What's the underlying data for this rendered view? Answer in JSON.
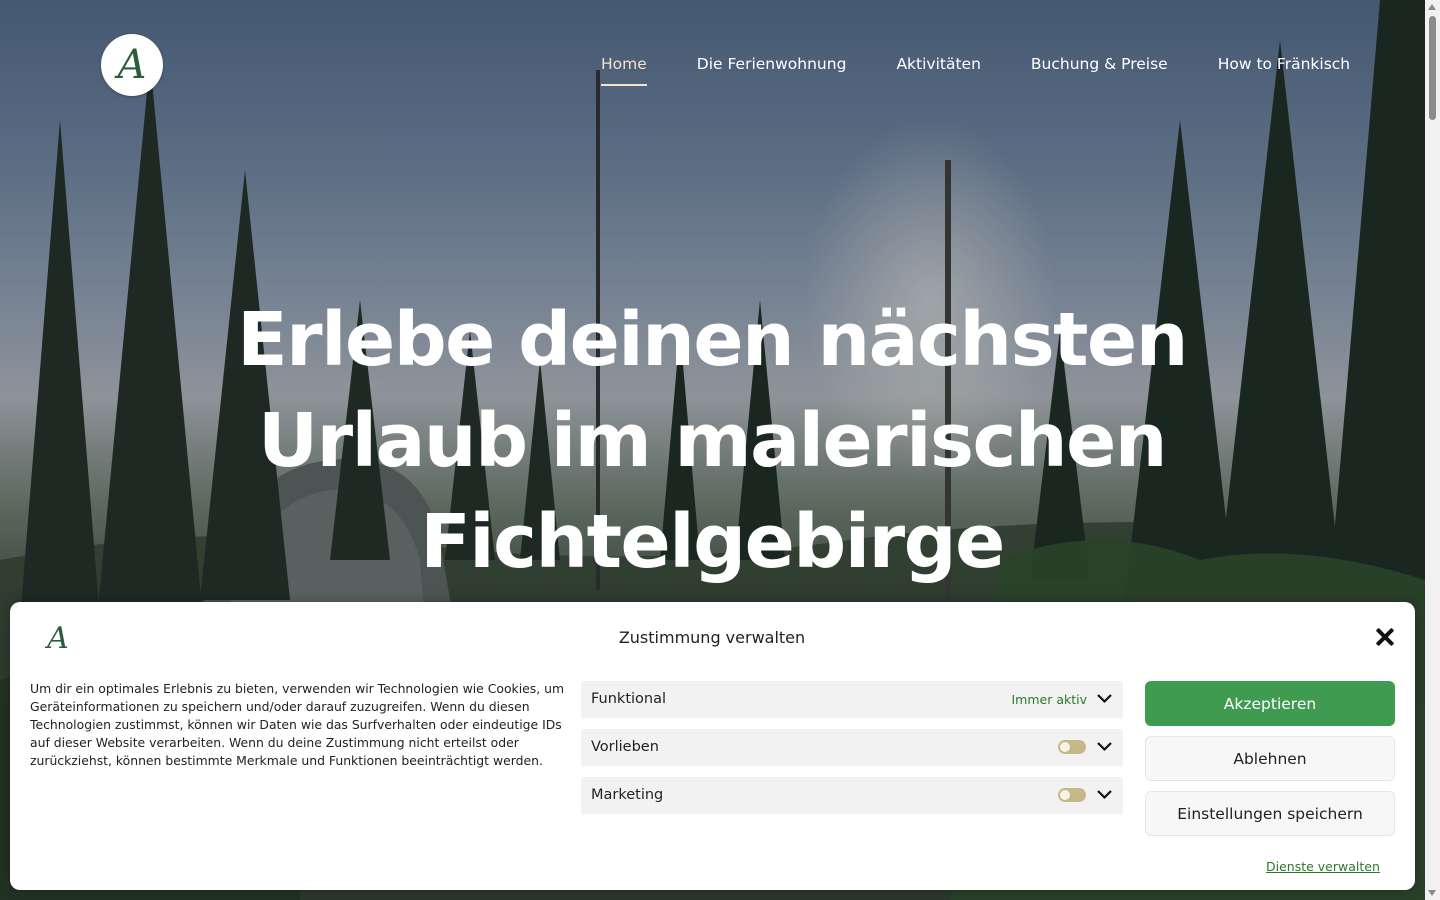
{
  "header": {
    "logo_alt": "A",
    "nav": [
      {
        "label": "Home",
        "active": true
      },
      {
        "label": "Die Ferienwohnung",
        "active": false
      },
      {
        "label": "Aktivitäten",
        "active": false
      },
      {
        "label": "Buchung & Preise",
        "active": false
      },
      {
        "label": "How to Fränkisch",
        "active": false
      }
    ]
  },
  "hero": {
    "headline_line1": "Erlebe deinen nächsten",
    "headline_line2": "Urlaub im malerischen",
    "headline_line3": "Fichtelgebirge"
  },
  "consent": {
    "logo_mark": "A",
    "title": "Zustimmung verwalten",
    "text": "Um dir ein optimales Erlebnis zu bieten, verwenden wir Technologien wie Cookies, um Geräteinformationen zu speichern und/oder darauf zuzugreifen. Wenn du diesen Technologien zustimmst, können wir Daten wie das Surfverhalten oder eindeutige IDs auf dieser Website verarbeiten. Wenn du deine Zustimmung nicht erteilst oder zurückziehst, können bestimmte Merkmale und Funktionen beeinträchtigt werden.",
    "categories": [
      {
        "label": "Funktional",
        "status": "Immer aktiv"
      },
      {
        "label": "Vorlieben",
        "status": ""
      },
      {
        "label": "Marketing",
        "status": ""
      }
    ],
    "accept_label": "Akzeptieren",
    "deny_label": "Ablehnen",
    "save_label": "Einstellungen speichern",
    "manage_label": "Dienste verwalten"
  },
  "colors": {
    "accent_green": "#3f9b50",
    "link_green": "#2b7a2b",
    "nav_active": "#f3e3c8"
  }
}
